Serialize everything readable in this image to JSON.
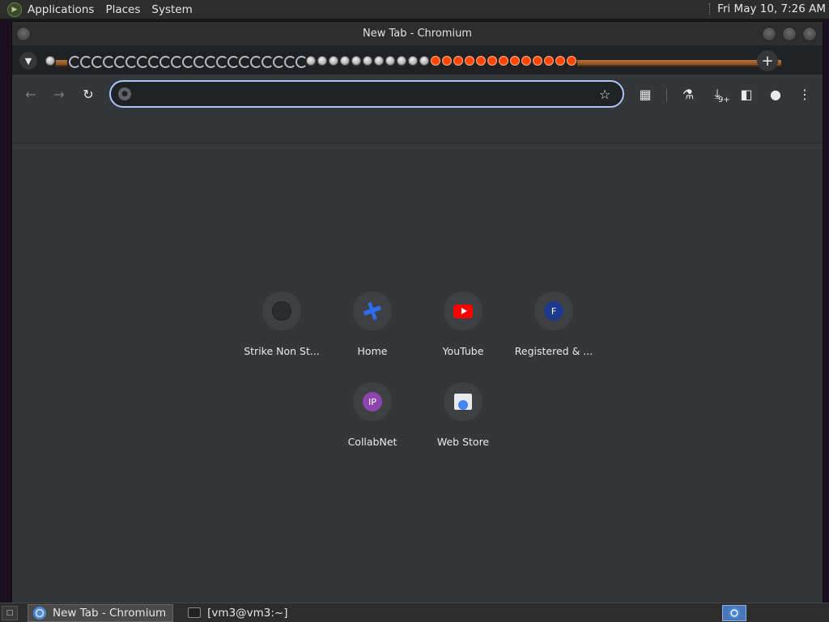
{
  "top_panel": {
    "menus": [
      "Applications",
      "Places",
      "System"
    ],
    "clock": "Fri May 10,  7:26 AM"
  },
  "window": {
    "title": "New Tab - Chromium"
  },
  "tabstrip": {
    "favicons": [
      "ball",
      "ship",
      "moon",
      "moon",
      "moon",
      "moon",
      "moon",
      "moon",
      "moon",
      "moon",
      "moon",
      "moon",
      "moon",
      "moon",
      "moon",
      "moon",
      "moon",
      "moon",
      "moon",
      "moon",
      "moon",
      "moon",
      "moon",
      "ball",
      "ball",
      "ball",
      "ball",
      "ball",
      "ball",
      "ball",
      "ball",
      "ball",
      "ball",
      "ball",
      "reddit",
      "reddit",
      "reddit",
      "reddit",
      "reddit",
      "reddit",
      "reddit",
      "reddit",
      "reddit",
      "reddit",
      "reddit",
      "reddit",
      "reddit",
      "ship",
      "ship",
      "ship",
      "ship",
      "ship",
      "ship",
      "ship",
      "ship",
      "ship",
      "ship",
      "ship",
      "ship",
      "ship",
      "ship",
      "ship",
      "ship",
      "ship",
      "ship"
    ],
    "tab_search_icon": "chevron-down-icon",
    "new_tab_icon": "plus-icon"
  },
  "toolbar": {
    "back_icon": "arrow-left-icon",
    "forward_icon": "arrow-right-icon",
    "reload_icon": "reload-icon",
    "omnibox_value": "",
    "omnibox_placeholder": "",
    "download_badge": "9+"
  },
  "ntp": {
    "shortcuts": [
      {
        "label": "Strike Non St...",
        "icon": "strike"
      },
      {
        "label": "Home",
        "icon": "home"
      },
      {
        "label": "YouTube",
        "icon": "youtube"
      },
      {
        "label": "Registered & ...",
        "icon": "letter",
        "letter": "F",
        "color": "#1e3a8a"
      },
      {
        "label": "CollabNet",
        "icon": "letter",
        "letter": "IP",
        "color": "#8e44ad"
      },
      {
        "label": "Web Store",
        "icon": "store"
      }
    ]
  },
  "taskbar": {
    "show_desktop_label": "□",
    "tasks": [
      {
        "label": "New Tab - Chromium",
        "active": true,
        "icon": "chromium"
      },
      {
        "label": "[vm3@vm3:~]",
        "active": false,
        "icon": "term"
      }
    ]
  }
}
